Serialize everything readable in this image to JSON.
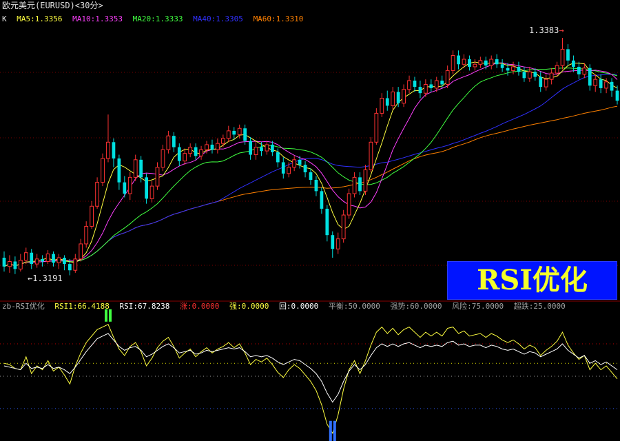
{
  "window": {
    "title": "欧元美元(EURUSD)<30分>"
  },
  "ma_indicator": {
    "label": "K",
    "items": [
      {
        "name": "MA5:1.3356",
        "color": "#ffff40"
      },
      {
        "name": "MA10:1.3353",
        "color": "#ff40ff"
      },
      {
        "name": "MA20:1.3333",
        "color": "#40ff40"
      },
      {
        "name": "MA40:1.3305",
        "color": "#3030ff"
      },
      {
        "name": "MA60:1.3310",
        "color": "#ff8000"
      }
    ]
  },
  "price_labels": {
    "high": "1.3383",
    "low": "1.3191"
  },
  "watermark": {
    "text": "RSI优化"
  },
  "rsi_indicator": {
    "label": "zb-RSI优化",
    "items": [
      {
        "name": "RSI1:66.4188",
        "color": "#ffff40"
      },
      {
        "name": "RSI:67.8238",
        "color": "#ffffff"
      },
      {
        "name": "涨:0.0000",
        "color": "#ff3030"
      },
      {
        "name": "强:0.0000",
        "color": "#ffff40"
      },
      {
        "name": "回:0.0000",
        "color": "#ffffff"
      },
      {
        "name": "平衡:50.0000",
        "color": "#a0a0a0"
      },
      {
        "name": "强势:60.0000",
        "color": "#a0a0a0"
      },
      {
        "name": "风险:75.0000",
        "color": "#a0a0a0"
      },
      {
        "name": "超跌:25.0000",
        "color": "#a0a0a0"
      }
    ]
  },
  "chart_data": [
    {
      "type": "candlestick",
      "title": "欧元美元(EURUSD)<30分>",
      "price_high": 1.3383,
      "price_low": 1.3191,
      "ohlc": [
        [
          1.3208,
          1.3201,
          1.3213,
          1.3197
        ],
        [
          1.3201,
          1.3205,
          1.321,
          1.3196
        ],
        [
          1.3205,
          1.3199,
          1.3209,
          1.3195
        ],
        [
          1.3199,
          1.3206,
          1.3211,
          1.3197
        ],
        [
          1.3206,
          1.3212,
          1.3216,
          1.3203
        ],
        [
          1.3212,
          1.3203,
          1.3215,
          1.3199
        ],
        [
          1.3203,
          1.3207,
          1.3211,
          1.32
        ],
        [
          1.3207,
          1.3205,
          1.321,
          1.3201
        ],
        [
          1.3205,
          1.3211,
          1.3214,
          1.3203
        ],
        [
          1.3211,
          1.3204,
          1.3213,
          1.3201
        ],
        [
          1.3204,
          1.3208,
          1.3211,
          1.3199
        ],
        [
          1.3208,
          1.3203,
          1.321,
          1.3198
        ],
        [
          1.3203,
          1.3198,
          1.3207,
          1.3194
        ],
        [
          1.3198,
          1.3207,
          1.3211,
          1.3196
        ],
        [
          1.3207,
          1.3219,
          1.3223,
          1.3205
        ],
        [
          1.3219,
          1.3233,
          1.3237,
          1.3216
        ],
        [
          1.3233,
          1.3249,
          1.3253,
          1.3231
        ],
        [
          1.3249,
          1.3268,
          1.3272,
          1.3247
        ],
        [
          1.3268,
          1.3287,
          1.3291,
          1.3265
        ],
        [
          1.3287,
          1.33,
          1.3322,
          1.3284
        ],
        [
          1.33,
          1.3287,
          1.3303,
          1.328
        ],
        [
          1.3287,
          1.3268,
          1.329,
          1.3262
        ],
        [
          1.3268,
          1.3259,
          1.3273,
          1.3256
        ],
        [
          1.3259,
          1.3272,
          1.3276,
          1.3254
        ],
        [
          1.3272,
          1.3286,
          1.329,
          1.3269
        ],
        [
          1.3286,
          1.3272,
          1.3289,
          1.3268
        ],
        [
          1.3272,
          1.3255,
          1.3275,
          1.3251
        ],
        [
          1.3255,
          1.3265,
          1.3269,
          1.3252
        ],
        [
          1.3265,
          1.328,
          1.3284,
          1.3262
        ],
        [
          1.328,
          1.3294,
          1.3298,
          1.3277
        ],
        [
          1.3294,
          1.3305,
          1.3309,
          1.3291
        ],
        [
          1.3305,
          1.3296,
          1.3308,
          1.3292
        ],
        [
          1.3296,
          1.3285,
          1.3299,
          1.3281
        ],
        [
          1.3285,
          1.3291,
          1.3295,
          1.3282
        ],
        [
          1.3291,
          1.3296,
          1.3299,
          1.3288
        ],
        [
          1.3296,
          1.3289,
          1.3299,
          1.3286
        ],
        [
          1.3289,
          1.3294,
          1.3297,
          1.3286
        ],
        [
          1.3294,
          1.3298,
          1.3301,
          1.3291
        ],
        [
          1.3298,
          1.3294,
          1.3302,
          1.3291
        ],
        [
          1.3294,
          1.3299,
          1.3303,
          1.3291
        ],
        [
          1.3299,
          1.3303,
          1.3306,
          1.3296
        ],
        [
          1.3303,
          1.3309,
          1.3313,
          1.33
        ],
        [
          1.3309,
          1.3306,
          1.3312,
          1.3302
        ],
        [
          1.3306,
          1.3311,
          1.3314,
          1.3303
        ],
        [
          1.3311,
          1.3301,
          1.3314,
          1.3298
        ],
        [
          1.3301,
          1.329,
          1.3304,
          1.3286
        ],
        [
          1.329,
          1.3296,
          1.33,
          1.3286
        ],
        [
          1.3296,
          1.3293,
          1.33,
          1.3289
        ],
        [
          1.3293,
          1.3298,
          1.3301,
          1.329
        ],
        [
          1.3298,
          1.3292,
          1.3301,
          1.3289
        ],
        [
          1.3292,
          1.3284,
          1.3295,
          1.328
        ],
        [
          1.3284,
          1.3275,
          1.3288,
          1.3271
        ],
        [
          1.3275,
          1.328,
          1.3284,
          1.3272
        ],
        [
          1.328,
          1.3286,
          1.3289,
          1.3277
        ],
        [
          1.3286,
          1.3282,
          1.3289,
          1.3279
        ],
        [
          1.3282,
          1.3276,
          1.3285,
          1.3272
        ],
        [
          1.3276,
          1.327,
          1.3279,
          1.3266
        ],
        [
          1.327,
          1.3261,
          1.3273,
          1.3257
        ],
        [
          1.3261,
          1.3247,
          1.3264,
          1.3243
        ],
        [
          1.3247,
          1.3226,
          1.325,
          1.3221
        ],
        [
          1.3226,
          1.3215,
          1.3229,
          1.3208
        ],
        [
          1.3215,
          1.3223,
          1.3228,
          1.3211
        ],
        [
          1.3223,
          1.3242,
          1.3246,
          1.322
        ],
        [
          1.3242,
          1.3259,
          1.3263,
          1.3239
        ],
        [
          1.3259,
          1.3272,
          1.3276,
          1.3256
        ],
        [
          1.3272,
          1.3261,
          1.3276,
          1.3258
        ],
        [
          1.3261,
          1.3278,
          1.3282,
          1.3258
        ],
        [
          1.3278,
          1.33,
          1.3304,
          1.3276
        ],
        [
          1.33,
          1.3323,
          1.3327,
          1.3298
        ],
        [
          1.3323,
          1.3335,
          1.3339,
          1.332
        ],
        [
          1.3335,
          1.3329,
          1.3341,
          1.3325
        ],
        [
          1.3329,
          1.334,
          1.3344,
          1.3326
        ],
        [
          1.334,
          1.3331,
          1.3344,
          1.3328
        ],
        [
          1.3331,
          1.3342,
          1.3346,
          1.3328
        ],
        [
          1.3342,
          1.3349,
          1.3353,
          1.3339
        ],
        [
          1.3349,
          1.3344,
          1.3352,
          1.334
        ],
        [
          1.3344,
          1.3339,
          1.3349,
          1.3335
        ],
        [
          1.3339,
          1.3346,
          1.335,
          1.3336
        ],
        [
          1.3346,
          1.3343,
          1.335,
          1.334
        ],
        [
          1.3343,
          1.3349,
          1.3352,
          1.334
        ],
        [
          1.3349,
          1.3346,
          1.3353,
          1.3343
        ],
        [
          1.3346,
          1.3357,
          1.3361,
          1.3343
        ],
        [
          1.3357,
          1.3369,
          1.3373,
          1.3354
        ],
        [
          1.3369,
          1.3362,
          1.3373,
          1.3358
        ],
        [
          1.3362,
          1.3366,
          1.337,
          1.3359
        ],
        [
          1.3366,
          1.336,
          1.3369,
          1.3357
        ],
        [
          1.336,
          1.3362,
          1.3366,
          1.3357
        ],
        [
          1.3362,
          1.3365,
          1.3368,
          1.3359
        ],
        [
          1.3365,
          1.3361,
          1.3368,
          1.3358
        ],
        [
          1.3361,
          1.3366,
          1.3369,
          1.3358
        ],
        [
          1.3366,
          1.3362,
          1.337,
          1.3359
        ],
        [
          1.3362,
          1.3359,
          1.3366,
          1.3356
        ],
        [
          1.3359,
          1.3357,
          1.3363,
          1.3353
        ],
        [
          1.3357,
          1.336,
          1.3364,
          1.3354
        ],
        [
          1.336,
          1.3356,
          1.3364,
          1.3353
        ],
        [
          1.3356,
          1.3351,
          1.336,
          1.3348
        ],
        [
          1.3351,
          1.3356,
          1.336,
          1.3348
        ],
        [
          1.3356,
          1.3352,
          1.3359,
          1.3349
        ],
        [
          1.3352,
          1.3344,
          1.3356,
          1.334
        ],
        [
          1.3344,
          1.335,
          1.3354,
          1.3341
        ],
        [
          1.335,
          1.3355,
          1.3359,
          1.3346
        ],
        [
          1.3355,
          1.3361,
          1.3364,
          1.3352
        ],
        [
          1.3361,
          1.3374,
          1.3383,
          1.3358
        ],
        [
          1.3374,
          1.3365,
          1.3378,
          1.3361
        ],
        [
          1.3365,
          1.336,
          1.3369,
          1.3356
        ],
        [
          1.336,
          1.3354,
          1.3364,
          1.335
        ],
        [
          1.3354,
          1.3359,
          1.3363,
          1.3351
        ],
        [
          1.3359,
          1.3345,
          1.3362,
          1.3341
        ],
        [
          1.3345,
          1.335,
          1.3354,
          1.334
        ],
        [
          1.335,
          1.3343,
          1.3354,
          1.3339
        ],
        [
          1.3343,
          1.3348,
          1.3351,
          1.3339
        ],
        [
          1.3348,
          1.3341,
          1.3351,
          1.3336
        ],
        [
          1.3341,
          1.3333,
          1.3345,
          1.333
        ]
      ]
    },
    {
      "type": "line",
      "title": "zb-RSI优化",
      "ylim": [
        0,
        100
      ],
      "reference_lines": [
        25,
        50,
        60,
        75
      ],
      "series": [
        {
          "name": "RSI1",
          "color": "#ffff40",
          "values": [
            60,
            59,
            56,
            55,
            65,
            52,
            58,
            55,
            62,
            54,
            57,
            51,
            44,
            58,
            68,
            76,
            81,
            86,
            88,
            90,
            80,
            71,
            66,
            73,
            76,
            69,
            58,
            64,
            72,
            77,
            80,
            73,
            64,
            68,
            71,
            65,
            69,
            72,
            68,
            71,
            73,
            76,
            72,
            75,
            68,
            59,
            63,
            61,
            64,
            59,
            53,
            49,
            55,
            59,
            56,
            51,
            46,
            39,
            28,
            13,
            6,
            20,
            40,
            55,
            62,
            52,
            62,
            74,
            84,
            88,
            83,
            87,
            82,
            86,
            88,
            84,
            80,
            84,
            81,
            84,
            81,
            87,
            88,
            83,
            85,
            81,
            82,
            83,
            80,
            83,
            81,
            78,
            76,
            78,
            75,
            71,
            74,
            72,
            66,
            70,
            73,
            77,
            84,
            74,
            68,
            63,
            66,
            55,
            60,
            55,
            58,
            53,
            48
          ]
        },
        {
          "name": "RSI",
          "color": "#ffffff",
          "values": [
            58,
            57,
            56,
            55,
            60,
            56,
            57,
            56,
            59,
            56,
            57,
            55,
            52,
            57,
            63,
            69,
            74,
            79,
            81,
            83,
            78,
            73,
            70,
            72,
            73,
            70,
            65,
            67,
            70,
            73,
            75,
            72,
            68,
            69,
            70,
            67,
            68,
            70,
            69,
            70,
            71,
            72,
            71,
            72,
            69,
            65,
            66,
            65,
            66,
            64,
            61,
            59,
            61,
            63,
            62,
            59,
            56,
            52,
            46,
            37,
            30,
            36,
            46,
            54,
            59,
            55,
            59,
            66,
            72,
            75,
            73,
            75,
            73,
            75,
            76,
            74,
            72,
            74,
            73,
            74,
            73,
            76,
            77,
            74,
            75,
            73,
            74,
            74,
            72,
            74,
            73,
            71,
            70,
            71,
            69,
            67,
            69,
            68,
            65,
            67,
            69,
            71,
            75,
            70,
            67,
            64,
            66,
            60,
            62,
            59,
            61,
            58,
            55
          ]
        }
      ],
      "signals": [
        {
          "name": "强",
          "color": "#40ff40",
          "index": 19,
          "value": 90
        },
        {
          "name": "回",
          "color": "#3070ff",
          "index": 60,
          "value": 6
        }
      ]
    }
  ]
}
